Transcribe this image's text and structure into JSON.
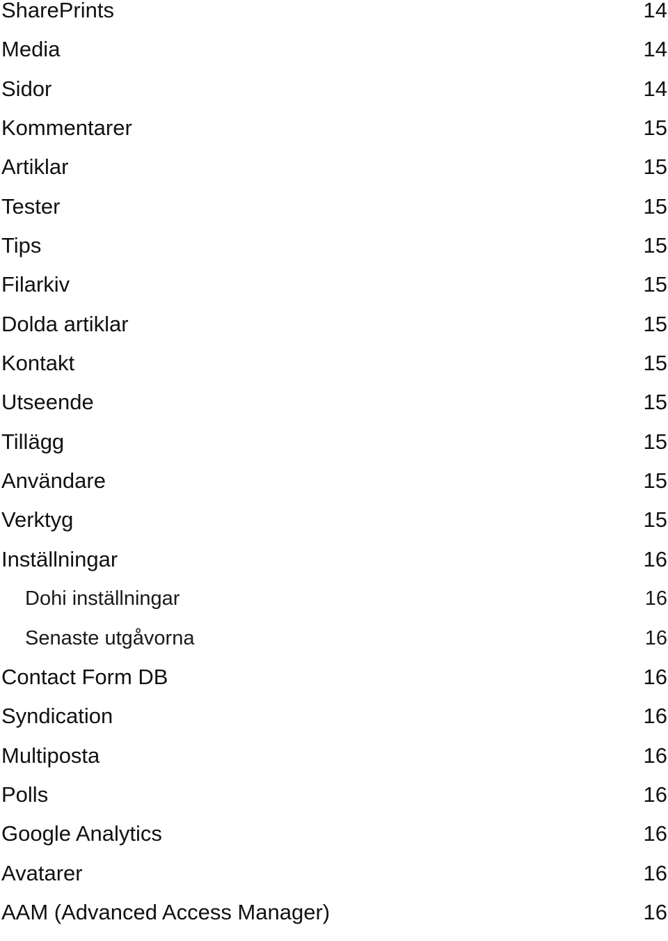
{
  "toc": {
    "entries": [
      {
        "label": "SharePrints",
        "page": "14",
        "level": 1
      },
      {
        "label": "Media",
        "page": "14",
        "level": 1
      },
      {
        "label": "Sidor",
        "page": "14",
        "level": 1
      },
      {
        "label": "Kommentarer",
        "page": "15",
        "level": 1
      },
      {
        "label": "Artiklar",
        "page": "15",
        "level": 1
      },
      {
        "label": "Tester",
        "page": "15",
        "level": 1
      },
      {
        "label": "Tips",
        "page": "15",
        "level": 1
      },
      {
        "label": "Filarkiv",
        "page": "15",
        "level": 1
      },
      {
        "label": "Dolda artiklar",
        "page": "15",
        "level": 1
      },
      {
        "label": "Kontakt",
        "page": "15",
        "level": 1
      },
      {
        "label": "Utseende",
        "page": "15",
        "level": 1
      },
      {
        "label": "Tillägg",
        "page": "15",
        "level": 1
      },
      {
        "label": "Användare",
        "page": "15",
        "level": 1
      },
      {
        "label": "Verktyg",
        "page": "15",
        "level": 1
      },
      {
        "label": "Inställningar",
        "page": "16",
        "level": 1
      },
      {
        "label": "Dohi inställningar",
        "page": "16",
        "level": 2
      },
      {
        "label": "Senaste utgåvorna",
        "page": "16",
        "level": 2
      },
      {
        "label": "Contact Form DB",
        "page": "16",
        "level": 1
      },
      {
        "label": "Syndication",
        "page": "16",
        "level": 1
      },
      {
        "label": "Multiposta",
        "page": "16",
        "level": 1
      },
      {
        "label": "Polls",
        "page": "16",
        "level": 1
      },
      {
        "label": "Google Analytics",
        "page": "16",
        "level": 1
      },
      {
        "label": "Avatarer",
        "page": "16",
        "level": 1
      },
      {
        "label": "AAM (Advanced Access Manager)",
        "page": "16",
        "level": 1
      }
    ]
  }
}
